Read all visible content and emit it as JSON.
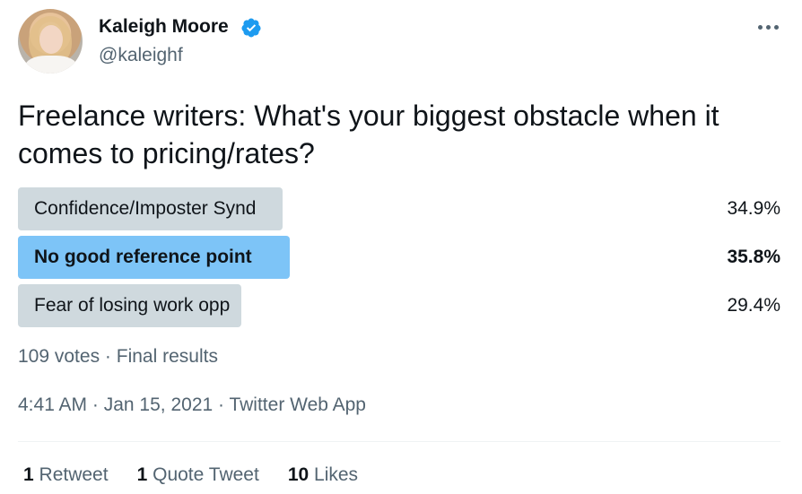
{
  "author": {
    "name": "Kaleigh Moore",
    "handle": "@kaleighf",
    "verified_color": "#1d9bf0"
  },
  "tweet": {
    "text": "Freelance writers: What's your biggest obstacle when it comes to pricing/rates?"
  },
  "poll": {
    "options": [
      {
        "label": "Confidence/Imposter Synd",
        "percent": "34.9%",
        "fraction": 0.349,
        "winner": false
      },
      {
        "label": "No good reference point",
        "percent": "35.8%",
        "fraction": 0.358,
        "winner": true
      },
      {
        "label": "Fear of losing work opp",
        "percent": "29.4%",
        "fraction": 0.294,
        "winner": false
      }
    ],
    "votes": "109 votes",
    "separator": " · ",
    "status": "Final results"
  },
  "meta": {
    "time": "4:41 AM",
    "date": "Jan 15, 2021",
    "source": "Twitter Web App",
    "separator": " · "
  },
  "stats": {
    "retweets_count": "1",
    "retweets_label": "Retweet",
    "quotes_count": "1",
    "quotes_label": "Quote Tweet",
    "likes_count": "10",
    "likes_label": "Likes"
  },
  "colors": {
    "bar": "#cfd9de",
    "bar_winner": "#7dc4f7",
    "secondary_text": "#536471"
  },
  "icons": {
    "verified": "verified-badge-icon",
    "more": "more-options-icon"
  }
}
